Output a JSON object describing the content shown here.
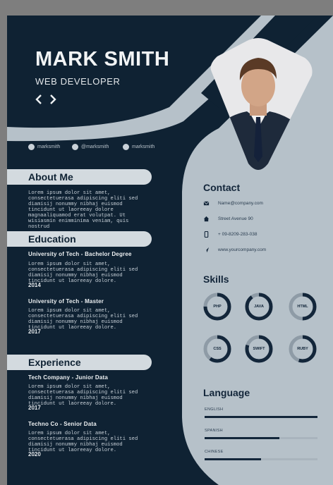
{
  "header": {
    "name": "MARK SMITH",
    "role": "WEB DEVELOPER"
  },
  "social": [
    {
      "icon": "facebook-icon",
      "handle": "marksmith"
    },
    {
      "icon": "twitter-icon",
      "handle": "@marksmith"
    },
    {
      "icon": "instagram-icon",
      "handle": "marksmith"
    }
  ],
  "about": {
    "title": "About Me",
    "text": "Lorem ipsum dolor sit amet, consectetuerasa adipiscing eliti sed diamisij nonummy nibhaj euismod tincidunt ut laoreeay dolore magnaaliquamod erat volutpat. Ut wisiasmin enimminima veniam, quis nostrud"
  },
  "education": {
    "title": "Education",
    "items": [
      {
        "title": "University of Tech - Bachelor Degree",
        "text": "Lorem ipsum dolor sit amet, consectetuerasa adipiscing eliti sed diamisij nonummy nibhaj euismod tincidunt ut laoreeay dolore.",
        "year": "2014"
      },
      {
        "title": "University of Tech - Master",
        "text": "Lorem ipsum dolor sit amet, consectetuerasa adipiscing eliti sed diamisij nonummy nibhaj euismod tincidunt ut laoreeay dolore.",
        "year": "2017"
      }
    ]
  },
  "experience": {
    "title": "Experience",
    "items": [
      {
        "title": "Tech Company - Junior Data",
        "text": "Lorem ipsum dolor sit amet, consectetuerasa adipiscing eliti sed diamisij nonummy nibhaj euismod tincidunt ut laoreeay dolore.",
        "year": "2017"
      },
      {
        "title": "Techno Co - Senior Data",
        "text": "Lorem ipsum dolor sit amet, consectetuerasa adipiscing eliti sed diamisij nonummy nibhaj euismod tincidunt ut laoreeay dolore.",
        "year": "2020"
      }
    ]
  },
  "contact": {
    "title": "Contact",
    "items": [
      {
        "icon": "email-icon",
        "text": "Name@company.com"
      },
      {
        "icon": "home-icon",
        "text": "Street Avenue 90"
      },
      {
        "icon": "phone-icon",
        "text": "+ 09-8209-283-038"
      },
      {
        "icon": "send-icon",
        "text": "www.yourcompany.com"
      }
    ]
  },
  "skills": {
    "title": "Skills",
    "items": [
      {
        "name": "PHP",
        "level": 0.75
      },
      {
        "name": "JAVA",
        "level": 0.9
      },
      {
        "name": "HTML",
        "level": 0.5
      },
      {
        "name": "CSS",
        "level": 0.6
      },
      {
        "name": "SWIFT",
        "level": 0.8
      },
      {
        "name": "RUBY",
        "level": 0.55
      }
    ]
  },
  "language": {
    "title": "Language",
    "items": [
      {
        "name": "ENGLISH",
        "level": 1.0
      },
      {
        "name": "SPANISH",
        "level": 0.66
      },
      {
        "name": "CHINESE",
        "level": 0.5
      }
    ]
  },
  "colors": {
    "navy": "#0f2233",
    "light": "#b6c1c9",
    "accent": "#13263a"
  }
}
